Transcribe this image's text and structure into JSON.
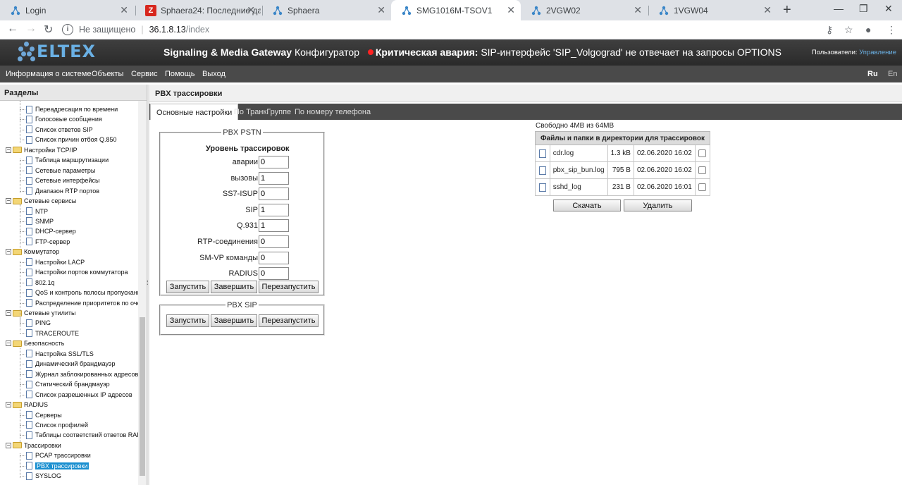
{
  "browser": {
    "tabs": [
      {
        "title": "Login",
        "favicon": "sphaera-icon"
      },
      {
        "title": "Sphaera24: Последние данные",
        "favicon": "zabbix-icon"
      },
      {
        "title": "Sphaera",
        "favicon": "sphaera-icon"
      },
      {
        "title": "SMG1016M-TSOV1",
        "favicon": "sphaera-icon"
      },
      {
        "title": "2VGW02",
        "favicon": "sphaera-icon"
      },
      {
        "title": "1VGW04",
        "favicon": "sphaera-icon"
      }
    ],
    "address": {
      "security": "Не защищено",
      "host": "36.1.8.13",
      "path": "/index"
    }
  },
  "header": {
    "logo": "ELTEX",
    "product": "Signaling & Media Gateway",
    "subtitle": "Конфигуратор",
    "alarm_label": "Критическая авария:",
    "alarm_text": "SIP-интерфейс 'SIP_Volgograd' не отвечает на запросы OPTIONS",
    "users_label": "Пользователи:",
    "users_link": "Управление"
  },
  "menu": {
    "items": [
      "Информация о системе",
      "Объекты",
      "Сервис",
      "Помощь",
      "Выход"
    ],
    "lang_ru": "Ru",
    "lang_en": "En"
  },
  "sidebar": {
    "title": "Разделы",
    "rows": [
      {
        "label": "Переадресация по времени",
        "type": "doc",
        "level": 2
      },
      {
        "label": "Голосовые сообщения",
        "type": "doc",
        "level": 2
      },
      {
        "label": "Список ответов SIP",
        "type": "doc",
        "level": 2
      },
      {
        "label": "Список причин отбоя Q.850",
        "type": "doc",
        "level": 2
      },
      {
        "label": "Настройки TCP/IP",
        "type": "folder",
        "level": 1
      },
      {
        "label": "Таблица маршрутизации",
        "type": "doc",
        "level": 2
      },
      {
        "label": "Сетевые параметры",
        "type": "doc",
        "level": 2
      },
      {
        "label": "Сетевые интерфейсы",
        "type": "doc",
        "level": 2
      },
      {
        "label": "Диапазон RTP портов",
        "type": "doc",
        "level": 2
      },
      {
        "label": "Сетевые сервисы",
        "type": "folder",
        "level": 1
      },
      {
        "label": "NTP",
        "type": "doc",
        "level": 2
      },
      {
        "label": "SNMP",
        "type": "doc",
        "level": 2
      },
      {
        "label": "DHCP-сервер",
        "type": "doc",
        "level": 2
      },
      {
        "label": "FTP-сервер",
        "type": "doc",
        "level": 2
      },
      {
        "label": "Коммутатор",
        "type": "folder",
        "level": 1
      },
      {
        "label": "Настройки LACP",
        "type": "doc",
        "level": 2
      },
      {
        "label": "Настройки портов коммутатора",
        "type": "doc",
        "level": 2
      },
      {
        "label": "802.1q",
        "type": "doc",
        "level": 2
      },
      {
        "label": "QoS и контроль полосы пропускани",
        "type": "doc",
        "level": 2
      },
      {
        "label": "Распределение приоритетов по оче",
        "type": "doc",
        "level": 2
      },
      {
        "label": "Сетевые утилиты",
        "type": "folder",
        "level": 1
      },
      {
        "label": "PING",
        "type": "doc",
        "level": 2
      },
      {
        "label": "TRACEROUTE",
        "type": "doc",
        "level": 2
      },
      {
        "label": "Безопасность",
        "type": "folder",
        "level": 1
      },
      {
        "label": "Настройка SSL/TLS",
        "type": "doc",
        "level": 2
      },
      {
        "label": "Динамический брандмауэр",
        "type": "doc",
        "level": 2
      },
      {
        "label": "Журнал заблокированных адресов",
        "type": "doc",
        "level": 2
      },
      {
        "label": "Статический брандмауэр",
        "type": "doc",
        "level": 2
      },
      {
        "label": "Список разрешенных IP адресов",
        "type": "doc",
        "level": 2
      },
      {
        "label": "RADIUS",
        "type": "folder",
        "level": 1
      },
      {
        "label": "Серверы",
        "type": "doc",
        "level": 2
      },
      {
        "label": "Список профилей",
        "type": "doc",
        "level": 2
      },
      {
        "label": "Таблицы соответствий ответов RAI",
        "type": "doc",
        "level": 2
      },
      {
        "label": "Трассировки",
        "type": "folder",
        "level": 1
      },
      {
        "label": "PCAP трассировки",
        "type": "doc",
        "level": 2
      },
      {
        "label": "PBX трассировки",
        "type": "doc",
        "level": 2,
        "selected": true
      },
      {
        "label": "SYSLOG",
        "type": "doc",
        "level": 2
      }
    ]
  },
  "content": {
    "title": "PBX трассировки",
    "tabs": [
      "Основные настройки",
      "По ТранкГруппе",
      "По номеру телефона"
    ],
    "pstn": {
      "legend": "PBX PSTN",
      "level_title": "Уровень трассировок",
      "params": [
        {
          "label": "аварии",
          "value": "0"
        },
        {
          "label": "вызовы",
          "value": "1"
        },
        {
          "label": "SS7-ISUP",
          "value": "0"
        },
        {
          "label": "SIP",
          "value": "1"
        },
        {
          "label": "Q.931",
          "value": "1"
        },
        {
          "label": "RTP-соединения",
          "value": "0"
        },
        {
          "label": "SM-VP команды",
          "value": "0"
        },
        {
          "label": "RADIUS",
          "value": "0"
        }
      ]
    },
    "sip": {
      "legend": "PBX SIP"
    },
    "buttons": {
      "start": "Запустить",
      "stop": "Завершить",
      "restart": "Перезапустить"
    },
    "files": {
      "free": "Свободно 4MB из 64MB",
      "header": "Файлы и папки в директории для трассировок",
      "rows": [
        {
          "name": "cdr.log",
          "size": "1.3 kB",
          "date": "02.06.2020 16:02"
        },
        {
          "name": "pbx_sip_bun.log",
          "size": "795 B",
          "date": "02.06.2020 16:02"
        },
        {
          "name": "sshd_log",
          "size": "231 B",
          "date": "02.06.2020 16:01"
        }
      ],
      "download": "Скачать",
      "delete": "Удалить"
    }
  }
}
